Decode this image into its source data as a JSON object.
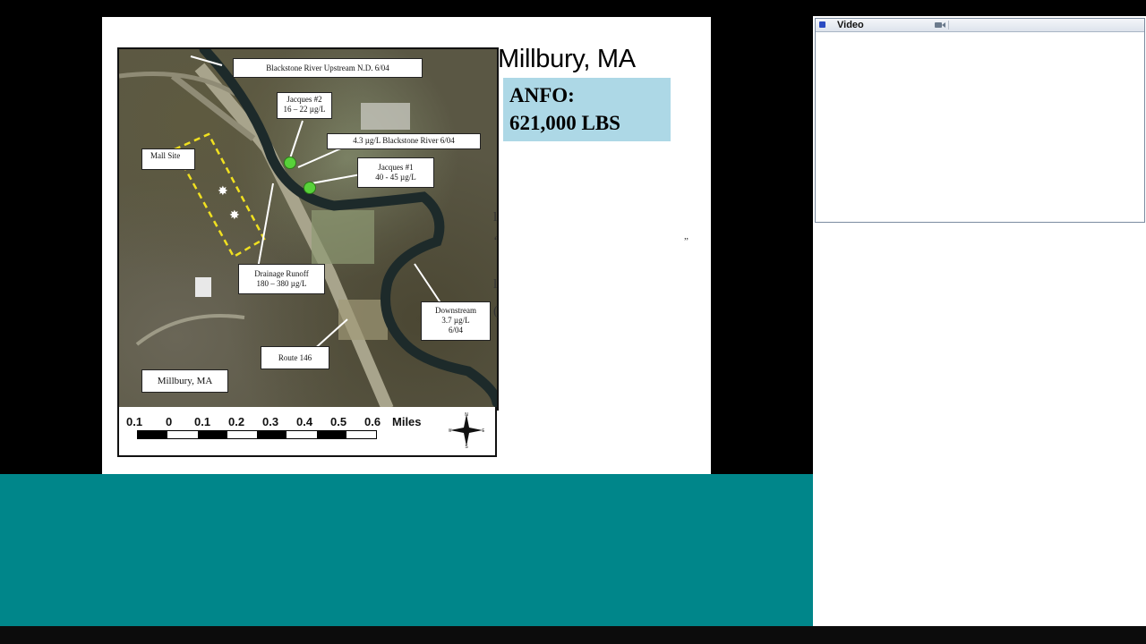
{
  "slide": {
    "title": "Millbury, MA",
    "anfo_label": "ANFO:",
    "anfo_amount": "621,000 LBS",
    "fragments": [
      "l",
      "‘",
      "l",
      "(",
      "”"
    ]
  },
  "map": {
    "labels": {
      "upstream": "Blackstone River Upstream N.D. 6/04",
      "jacques2_name": "Jacques #2",
      "jacques2_value": "16 – 22 µg/L",
      "blackstone_river": "4.3 µg/L Blackstone River 6/04",
      "jacques1_name": "Jacques #1",
      "jacques1_value": "40 - 45 µg/L",
      "mall_site": "Mall Site",
      "drainage_name": "Drainage Runoff",
      "drainage_value": "180 – 380 µg/L",
      "downstream_name": "Downstream",
      "downstream_value": "3.7 µg/L",
      "downstream_date": "6/04",
      "route": "Route 146",
      "town": "Millbury, MA"
    },
    "scale": {
      "ticks": [
        "0.1",
        "0",
        "0.1",
        "0.2",
        "0.3",
        "0.4",
        "0.5",
        "0.6"
      ],
      "unit": "Miles"
    },
    "compass_letters": {
      "n": "N",
      "s": "S",
      "e": "E",
      "w": "W"
    }
  },
  "video_window": {
    "title": "Video"
  },
  "colors": {
    "teal_band": "#00868a",
    "anfo_box": "#add8e6",
    "sample_dot": "#58d23a",
    "site_outline": "#f0e020"
  }
}
